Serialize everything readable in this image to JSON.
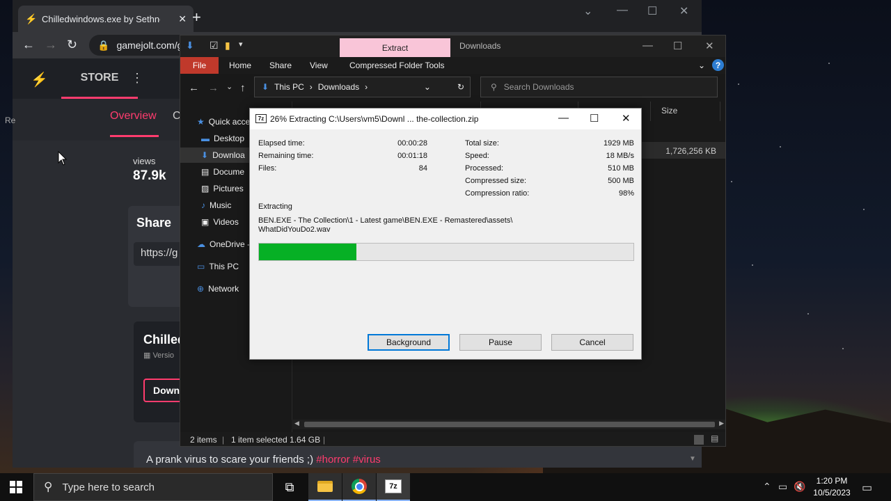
{
  "browser": {
    "tab_title": "Chilledwindows.exe by Sethnoo…",
    "url": "gamejolt.com/g",
    "nav": {
      "store": "STORE"
    },
    "subnav": {
      "overview": "Overview",
      "next_clip": "C"
    },
    "side_label": "Re",
    "stats": {
      "views_label": "views",
      "views_value": "87.9k"
    },
    "share": {
      "title": "Share",
      "input_value": "https://g"
    },
    "game": {
      "title": "Chilled",
      "version": "Versio",
      "download": "Down"
    },
    "description": {
      "text": "A prank virus to scare your friends ;) ",
      "tags": "#horror #virus"
    }
  },
  "explorer": {
    "context_tab": "Extract",
    "title": "Downloads",
    "ribbon_tabs": [
      "File",
      "Home",
      "Share",
      "View",
      "Compressed Folder Tools"
    ],
    "breadcrumb": [
      "This PC",
      "Downloads"
    ],
    "search_placeholder": "Search Downloads",
    "nav_items": [
      "Quick acce",
      "Desktop",
      "Downloa",
      "Docume",
      "Pictures",
      "Music",
      "Videos",
      "OneDrive -",
      "This PC",
      "Network"
    ],
    "column_size": "Size",
    "file_size": "1,726,256 KB",
    "status": {
      "items": "2 items",
      "selected": "1 item selected  1.64 GB"
    }
  },
  "dialog": {
    "title": "26% Extracting C:\\Users\\vm5\\Downl ... the-collection.zip",
    "left_stats": [
      {
        "label": "Elapsed time:",
        "value": "00:00:28"
      },
      {
        "label": "Remaining time:",
        "value": "00:01:18"
      },
      {
        "label": "Files:",
        "value": "84"
      }
    ],
    "right_stats": [
      {
        "label": "Total size:",
        "value": "1929 MB"
      },
      {
        "label": "Speed:",
        "value": "18 MB/s"
      },
      {
        "label": "Processed:",
        "value": "510 MB"
      },
      {
        "label": "Compressed size:",
        "value": "500 MB"
      },
      {
        "label": "Compression ratio:",
        "value": "98%"
      }
    ],
    "action": "Extracting",
    "file_path": "BEN.EXE - The Collection\\1 - Latest game\\BEN.EXE - Remastered\\assets\\ WhatDidYouDo2.wav",
    "progress": 0.26,
    "buttons": {
      "background": "Background",
      "pause": "Pause",
      "cancel": "Cancel"
    }
  },
  "taskbar": {
    "search_placeholder": "Type here to search",
    "time": "1:20 PM",
    "date": "10/5/2023"
  },
  "colors": {
    "accent": "#ff3c6e",
    "progress": "#06b025",
    "extract_tab": "#f9c5d8",
    "file_tab": "#c0392b"
  }
}
